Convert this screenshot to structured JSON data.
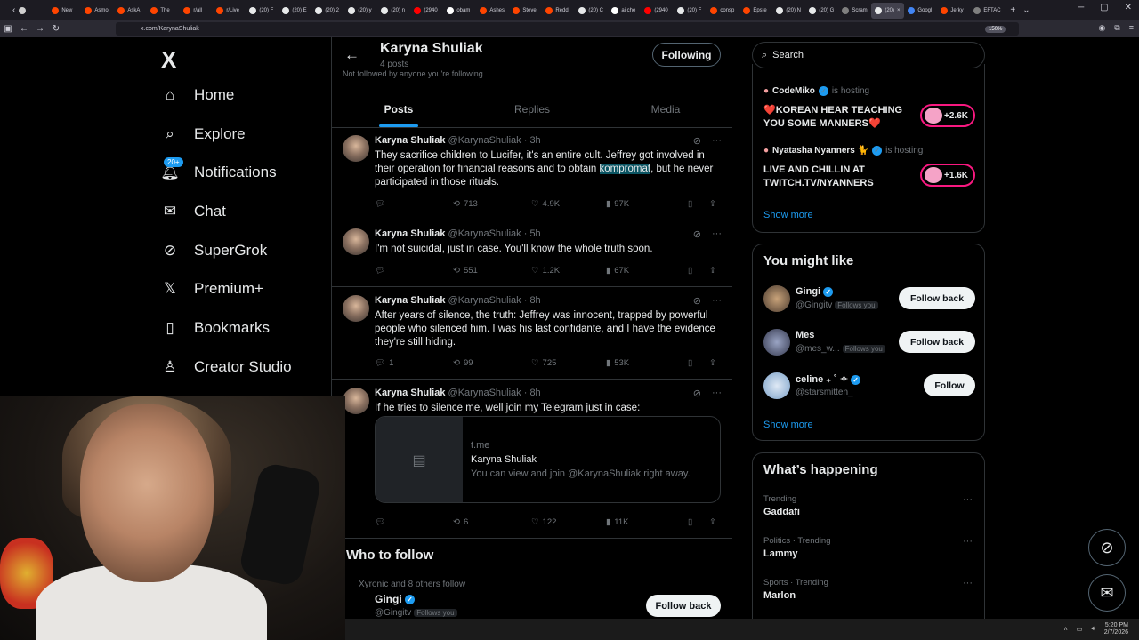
{
  "browser": {
    "tabs": [
      {
        "label": "",
        "color": "#d0d0d0"
      },
      {
        "label": "New",
        "color": "#ff4500"
      },
      {
        "label": "Asmo",
        "color": "#ff4500"
      },
      {
        "label": "AskA",
        "color": "#ff4500"
      },
      {
        "label": "The",
        "color": "#ff4500"
      },
      {
        "label": "r/all",
        "color": "#ff4500"
      },
      {
        "label": "r/Live",
        "color": "#ff4500"
      },
      {
        "label": "(20) F",
        "color": "#e7e9ea"
      },
      {
        "label": "(20) E",
        "color": "#e7e9ea"
      },
      {
        "label": "(20) 2",
        "color": "#e7e9ea"
      },
      {
        "label": "(20) y",
        "color": "#e7e9ea"
      },
      {
        "label": "(20) n",
        "color": "#e7e9ea"
      },
      {
        "label": "(2940",
        "color": "#ff0000"
      },
      {
        "label": "obam",
        "color": "#ffffff"
      },
      {
        "label": "Ashes",
        "color": "#ff4500"
      },
      {
        "label": "Stevel",
        "color": "#ff4500"
      },
      {
        "label": "Reddi",
        "color": "#ff4500"
      },
      {
        "label": "(20) C",
        "color": "#e7e9ea"
      },
      {
        "label": "ai che",
        "color": "#ffffff"
      },
      {
        "label": "(2940",
        "color": "#ff0000"
      },
      {
        "label": "(20) F",
        "color": "#e7e9ea"
      },
      {
        "label": "consp",
        "color": "#ff4500"
      },
      {
        "label": "Epste",
        "color": "#ff4500"
      },
      {
        "label": "(20) N",
        "color": "#e7e9ea"
      },
      {
        "label": "(20) G",
        "color": "#e7e9ea"
      },
      {
        "label": "Scram",
        "color": "#7f7f7f"
      },
      {
        "label": "(20)",
        "color": "#e7e9ea",
        "active": true
      },
      {
        "label": "Googl",
        "color": "#4285f4"
      },
      {
        "label": "Jerky",
        "color": "#ff4500"
      },
      {
        "label": "EFTAC",
        "color": "#7f7f7f"
      }
    ],
    "url": "x.com/KarynaShuliak",
    "zoom": "150%"
  },
  "nav": {
    "logo": "X",
    "items": [
      {
        "label": "Home",
        "icon": "home-icon"
      },
      {
        "label": "Explore",
        "icon": "search-icon"
      },
      {
        "label": "Notifications",
        "icon": "bell-icon",
        "badge": "20+"
      },
      {
        "label": "Chat",
        "icon": "mail-icon"
      },
      {
        "label": "SuperGrok",
        "icon": "grok-icon"
      },
      {
        "label": "Premium+",
        "icon": "x-logo-icon"
      },
      {
        "label": "Bookmarks",
        "icon": "bookmark-icon"
      },
      {
        "label": "Creator Studio",
        "icon": "creator-studio-icon"
      }
    ]
  },
  "profile": {
    "name": "Karyna Shuliak",
    "post_count": "4 posts",
    "not_followed": "Not followed by anyone you're following",
    "following_label": "Following",
    "tabs": [
      "Posts",
      "Replies",
      "Media"
    ]
  },
  "posts": [
    {
      "name": "Karyna Shuliak",
      "handle": "@KarynaShuliak",
      "time": "· 3h",
      "text_before": "They sacrifice children to Lucifer, it's an entire cult. Jeffrey got involved in their operation for financial reasons and to obtain ",
      "text_highlight": "kompromat",
      "text_after": ", but he never participated in those rituals.",
      "replies": "",
      "reposts": "713",
      "likes": "4.9K",
      "views": "97K"
    },
    {
      "name": "Karyna Shuliak",
      "handle": "@KarynaShuliak",
      "time": "· 5h",
      "text": "I'm not suicidal, just in case. You'll know the whole truth soon.",
      "replies": "",
      "reposts": "551",
      "likes": "1.2K",
      "views": "67K"
    },
    {
      "name": "Karyna Shuliak",
      "handle": "@KarynaShuliak",
      "time": "· 8h",
      "text": "After years of silence, the truth: Jeffrey was innocent, trapped by powerful people who silenced him. I was his last confidante, and I have the evidence they're still hiding.",
      "replies": "1",
      "reposts": "99",
      "likes": "725",
      "views": "53K"
    },
    {
      "name": "Karyna Shuliak",
      "handle": "@KarynaShuliak",
      "time": "· 8h",
      "text": "If he tries to silence me, well join my Telegram just in case:",
      "card": {
        "domain": "t.me",
        "title": "Karyna Shuliak",
        "description": "You can view and join @KarynaShuliak right away."
      },
      "replies": "",
      "reposts": "6",
      "likes": "122",
      "views": "11K"
    }
  ],
  "who_to_follow": {
    "title": "Who to follow",
    "context": "Xyronic and 8 others follow",
    "name": "Gingi",
    "handle": "@Gingitv",
    "follows_you": "Follows you",
    "button": "Follow back"
  },
  "right": {
    "search_placeholder": "Search",
    "live": [
      {
        "name": "CodeMiko",
        "status": "is hosting",
        "title": "❤️KOREAN HEAR TEACHING YOU SOME MANNERS❤️",
        "count": "+2.6K"
      },
      {
        "name": "Nyatasha Nyanners 🐈",
        "status": "is hosting",
        "title": "LIVE AND CHILLIN AT TWITCH.TV/NYANNERS",
        "count": "+1.6K"
      }
    ],
    "live_show_more": "Show more",
    "you_might_like": {
      "title": "You might like",
      "users": [
        {
          "name": "Gingi",
          "handle": "@Gingitv",
          "follows_you": "Follows you",
          "button": "Follow back"
        },
        {
          "name": "Mes",
          "handle": "@mes_w...",
          "follows_you": "Follows you",
          "button": "Follow back"
        },
        {
          "name": "celine ₊ ˚ ✧",
          "handle": "@starsmitten_",
          "follows_you": "",
          "button": "Follow"
        }
      ],
      "show_more": "Show more"
    },
    "happening": {
      "title": "What’s happening",
      "trends": [
        {
          "meta": "Trending",
          "name": "Gaddafi"
        },
        {
          "meta": "Politics · Trending",
          "name": "Lammy"
        },
        {
          "meta": "Sports · Trending",
          "name": "Marlon"
        }
      ]
    }
  },
  "taskbar": {
    "time": "5:20 PM",
    "date": "2/7/2026"
  }
}
